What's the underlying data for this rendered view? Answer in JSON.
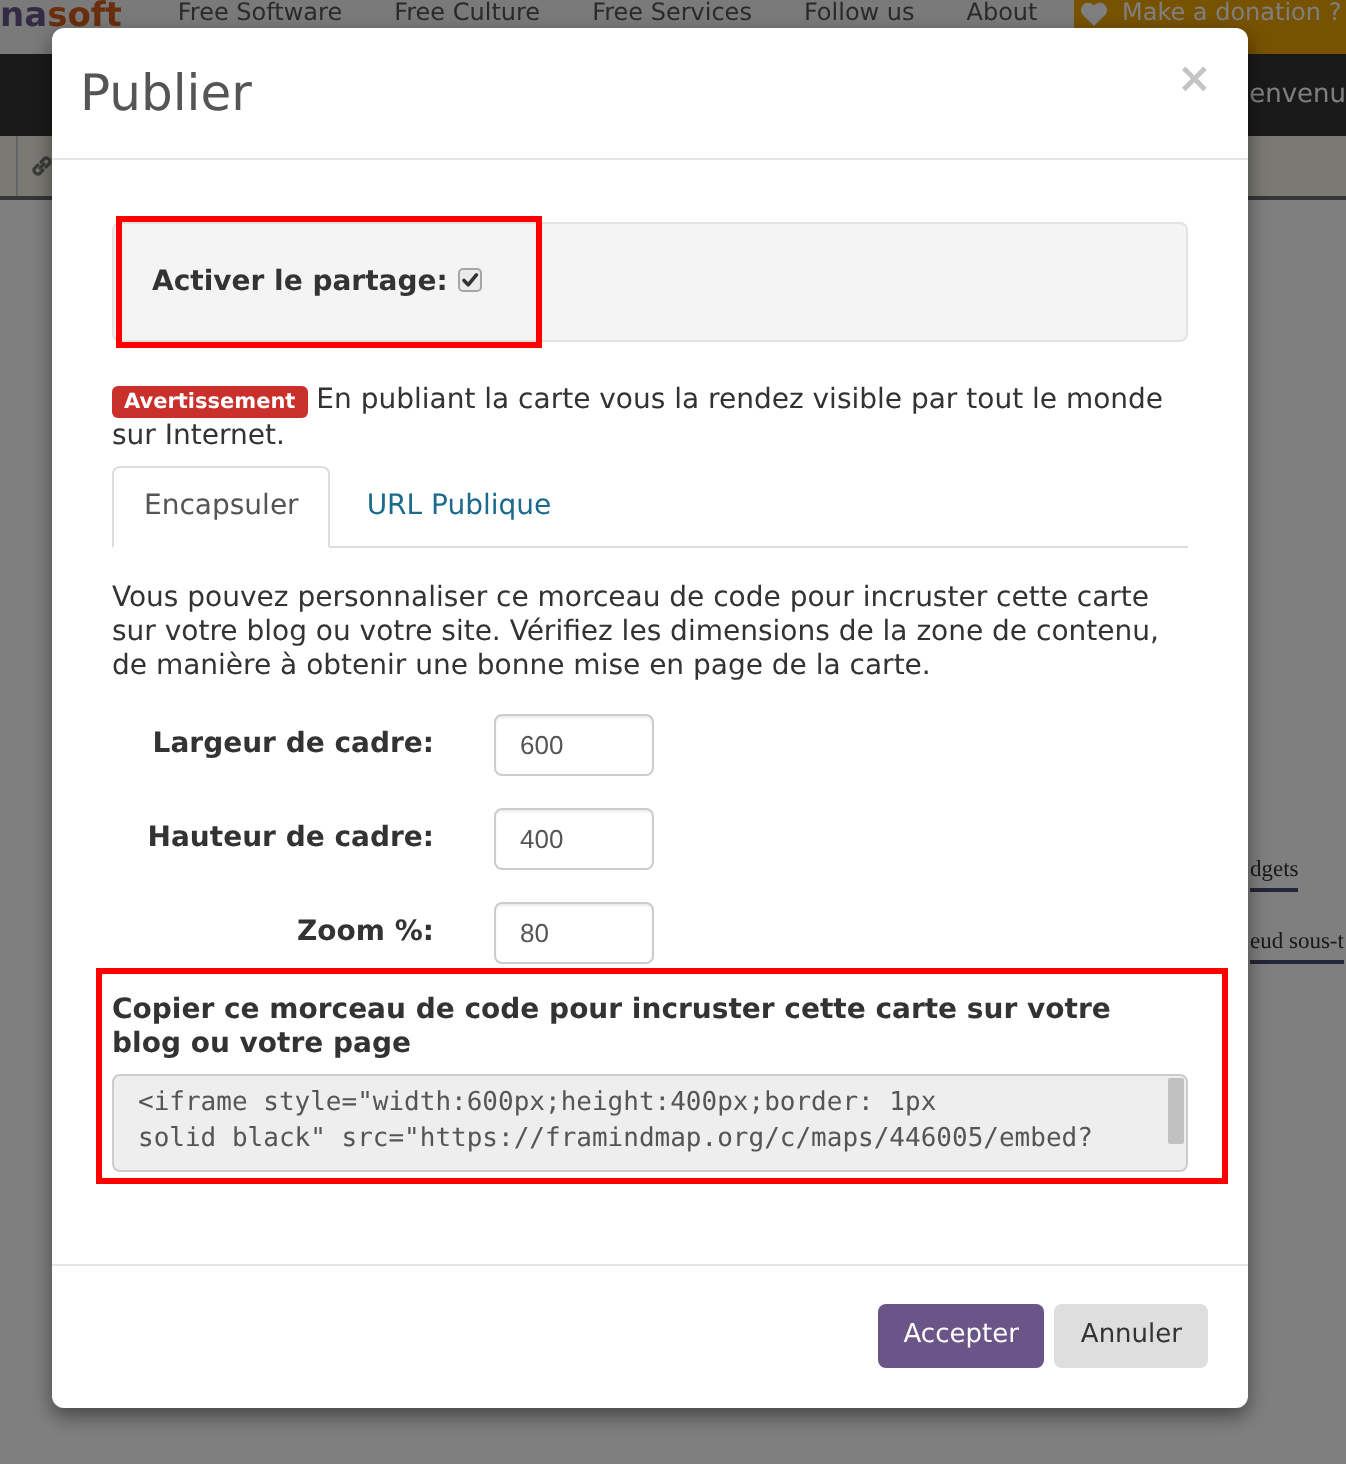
{
  "background_page": {
    "logo": [
      "na",
      "soft"
    ],
    "nav_links": [
      "Free Software",
      "Free Culture",
      "Free Services",
      "Follow us",
      "About"
    ],
    "donate_button": "Make a donation ?",
    "welcome_text": "envenu",
    "sidebar_links": [
      "dgets",
      "eud sous-t"
    ]
  },
  "dialog": {
    "title": "Publier",
    "close": "×",
    "sharing": {
      "label": "Activer le partage:",
      "checked": true,
      "highlighted": true
    },
    "warning": {
      "badge": "Avertissement",
      "text": "En publiant la carte vous la rendez visible par tout le monde sur Internet."
    },
    "tabs": [
      {
        "label": "Encapsuler",
        "selected": true
      },
      {
        "label": "URL Publique",
        "selected": false
      }
    ],
    "description": "Vous pouvez personnaliser ce morceau de code pour incruster cette carte sur votre blog ou votre site. Vérifiez les dimensions de la zone de contenu, de manière à obtenir une bonne mise en page de la carte.",
    "fields": [
      {
        "label": "Largeur de cadre:",
        "value": "600"
      },
      {
        "label": "Hauteur de cadre:",
        "value": "400"
      },
      {
        "label": "Zoom %:",
        "value": "80"
      }
    ],
    "embed": {
      "heading": "Copier ce morceau de code pour incruster cette carte sur votre blog ou votre page",
      "code": "<iframe style=\"width:600px;height:400px;border: 1px\nsolid black\" src=\"https://framindmap.org/c/maps/446005/embed?",
      "highlighted": true
    },
    "buttons": [
      {
        "label": "Accepter",
        "kind": "primary"
      },
      {
        "label": "Annuler",
        "kind": "secondary"
      }
    ]
  }
}
